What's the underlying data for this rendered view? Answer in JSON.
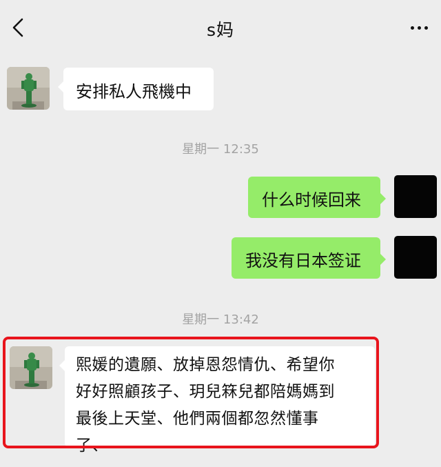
{
  "header": {
    "title": "s妈",
    "back_icon": "chevron-left-icon",
    "more_icon": "more-dots-icon"
  },
  "messages": [
    {
      "side": "left",
      "text": "安排私人飛機中"
    },
    {
      "timestamp": "星期一 12:35"
    },
    {
      "side": "right",
      "text": "什么时候回来"
    },
    {
      "side": "right",
      "text": "我没有日本签证"
    },
    {
      "timestamp": "星期一 13:42"
    },
    {
      "side": "left",
      "text": "熙媛的遺願、放掉恩怨情仇、希望你好好照顧孩子、玥兒箖兒都陪媽媽到最後上天堂、他們兩個都忽然懂事了、",
      "lines": [
        "熙媛的遺願、放掉恩怨情仇、希望你",
        "好好照顧孩子、玥兒箖兒都陪媽媽到",
        "最後上天堂、他們兩個都忽然懂事",
        "了、"
      ]
    }
  ],
  "colors": {
    "background": "#ededed",
    "self_bubble": "#95ec69",
    "other_bubble": "#ffffff",
    "highlight_border": "#e8141c"
  }
}
